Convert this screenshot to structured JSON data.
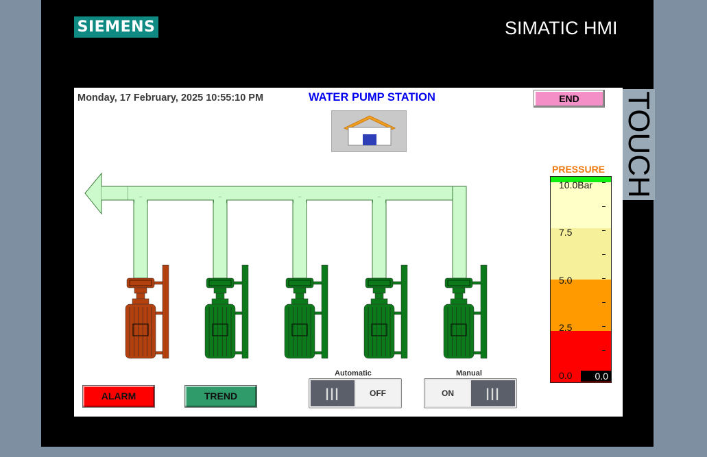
{
  "frame": {
    "brand": "SIEMENS",
    "model": "SIMATIC HMI",
    "side_label": "TOUCH"
  },
  "header": {
    "datetime": "Monday, 17 February, 2025 10:55:10 PM",
    "title": "WATER PUMP STATION",
    "end_label": "END"
  },
  "home": {
    "icon": "home-icon"
  },
  "pumps": [
    {
      "id": 1,
      "status": "fault",
      "color": "#b2410f"
    },
    {
      "id": 2,
      "status": "running",
      "color": "#0c7a1a"
    },
    {
      "id": 3,
      "status": "running",
      "color": "#0c7a1a"
    },
    {
      "id": 4,
      "status": "running",
      "color": "#0c7a1a"
    },
    {
      "id": 5,
      "status": "running",
      "color": "#0c7a1a"
    }
  ],
  "pressure": {
    "label": "PRESSURE",
    "value": "0.0",
    "max": 10.0,
    "scale": [
      "10.0Bar",
      "7.5",
      "5.0",
      "2.5",
      "0.0"
    ],
    "zones": [
      {
        "from": 7.5,
        "to": 10.0,
        "color": "#ffffc8"
      },
      {
        "from": 5.0,
        "to": 7.5,
        "color": "#f7f09a"
      },
      {
        "from": 2.5,
        "to": 5.0,
        "color": "#ff9a00"
      },
      {
        "from": 0.0,
        "to": 2.5,
        "color": "#ff0000"
      }
    ]
  },
  "buttons": {
    "alarm": "ALARM",
    "trend": "TREND"
  },
  "mode": {
    "automatic": {
      "caption": "Automatic",
      "state": "OFF"
    },
    "manual": {
      "caption": "Manual",
      "state": "ON"
    }
  },
  "colors": {
    "pipe": "#ccfacc",
    "pipe_outline": "#3a7a3a",
    "running": "#0c7a1a",
    "fault": "#b2410f"
  }
}
